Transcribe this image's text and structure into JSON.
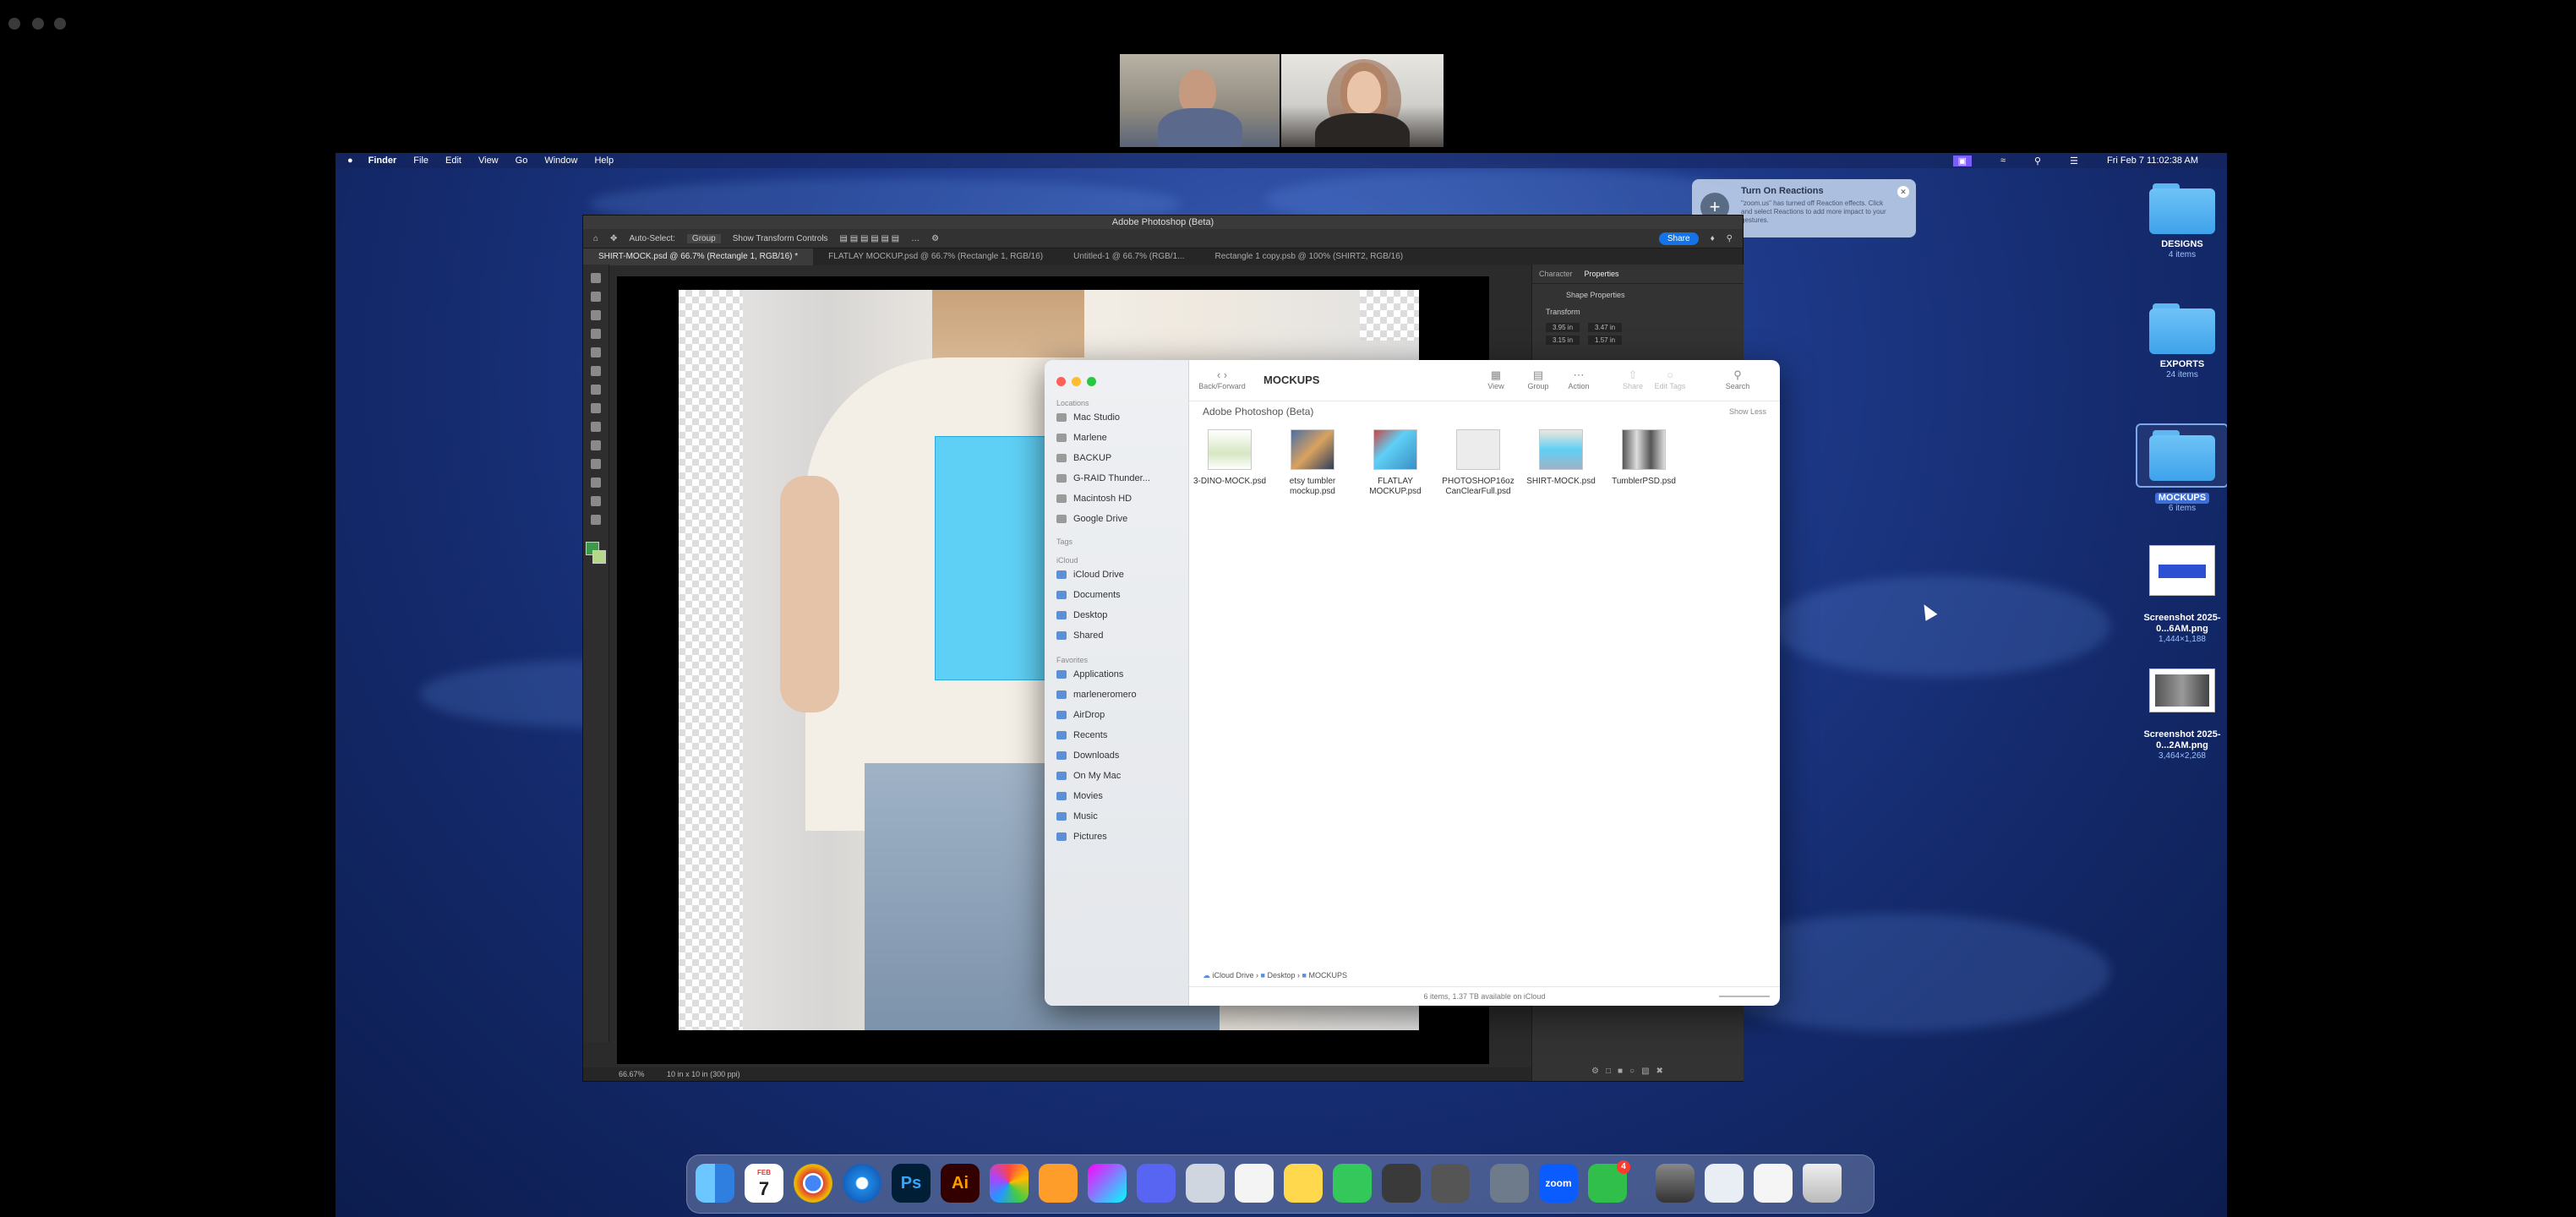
{
  "screen": {
    "menubar": {
      "app": "Finder",
      "menus": [
        "File",
        "Edit",
        "View",
        "Go",
        "Window",
        "Help"
      ],
      "clock": "Fri Feb 7  11:02:38 AM"
    },
    "notification": {
      "title": "Turn On Reactions",
      "body": "\"zoom.us\" has turned off Reaction effects. Click and select Reactions to add more impact to your gestures."
    },
    "desktop_items": [
      {
        "name": "DESIGNS",
        "sub": "4 items"
      },
      {
        "name": "EXPORTS",
        "sub": "24 items"
      },
      {
        "name": "MOCKUPS",
        "sub": "6 items"
      },
      {
        "name": "Screenshot 2025-0...6AM.png",
        "sub": "1,444×1,188"
      },
      {
        "name": "Screenshot 2025-0...2AM.png",
        "sub": "3,464×2,268"
      }
    ],
    "photoshop": {
      "title": "Adobe Photoshop (Beta)",
      "options": {
        "auto_select": "Auto-Select:",
        "group": "Group",
        "transform": "Show Transform Controls",
        "share": "Share"
      },
      "tabs": [
        "SHIRT-MOCK.psd @ 66.7% (Rectangle 1, RGB/16) *",
        "FLATLAY MOCKUP.psd @ 66.7% (Rectangle 1, RGB/16)",
        "Untitled-1 @ 66.7% (RGB/1...",
        "Rectangle 1 copy.psb @ 100% (SHIRT2, RGB/16)"
      ],
      "panel_tabs": [
        "Character",
        "Properties"
      ],
      "panel_section": "Shape Properties",
      "panel_transform": "Transform",
      "fields": {
        "w": "3.95 in",
        "h": "3.47 in",
        "x": "3.15 in",
        "y": "1.57 in"
      },
      "zoom": "66.67%",
      "doc_size": "10 in x 10 in (300 ppi)"
    },
    "finder": {
      "folder": "MOCKUPS",
      "back_forward": "Back/Forward",
      "toolbar": [
        "View",
        "Group",
        "Action",
        "Share",
        "Edit Tags",
        "Search"
      ],
      "section_path": "Adobe Photoshop (Beta)",
      "show_less": "Show Less",
      "sidebar": {
        "locations_label": "Locations",
        "locations": [
          "Mac Studio",
          "Marlene",
          "BACKUP",
          "G-RAID Thunder...",
          "Macintosh HD",
          "Google Drive"
        ],
        "tags_label": "Tags",
        "icloud_label": "iCloud",
        "icloud": [
          "iCloud Drive",
          "Documents",
          "Desktop",
          "Shared"
        ],
        "favorites_label": "Favorites",
        "favorites": [
          "Applications",
          "marleneromero",
          "AirDrop",
          "Recents",
          "Downloads",
          "On My Mac",
          "Movies",
          "Music",
          "Pictures"
        ]
      },
      "files": [
        {
          "name": "3-DINO-MOCK.psd"
        },
        {
          "name": "etsy tumbler mockup.psd"
        },
        {
          "name": "FLATLAY MOCKUP.psd"
        },
        {
          "name": "PHOTOSHOP16oz CanClearFull.psd"
        },
        {
          "name": "SHIRT-MOCK.psd"
        },
        {
          "name": "TumblerPSD.psd"
        }
      ],
      "breadcrumb": [
        "iCloud Drive",
        "Desktop",
        "MOCKUPS"
      ],
      "status": "6 items, 1.37 TB available on iCloud"
    },
    "dock": {
      "calendar_month": "FEB",
      "calendar_day": "7",
      "facetime_badge": "4",
      "zoom_label": "zoom",
      "ps_label": "Ps",
      "ai_label": "Ai"
    }
  }
}
